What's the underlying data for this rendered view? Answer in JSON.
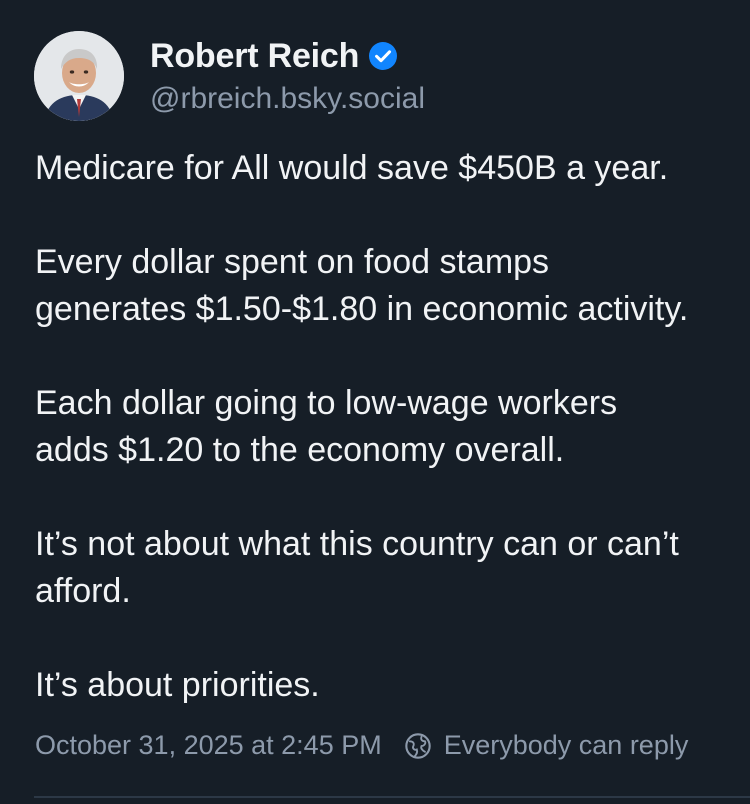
{
  "post": {
    "author": {
      "display_name": "Robert Reich",
      "handle": "@rbreich.bsky.social",
      "verified": true,
      "avatar_icon": "avatar-photo"
    },
    "text": "Medicare for All would save $450B a year.\n\nEvery dollar spent on food stamps\ngenerates $1.50-$1.80 in economic activity.\n\nEach dollar going to low-wage workers\nadds $1.20 to the economy overall.\n\nIt’s not about what this country can or can’t\nafford.\n\nIt’s about priorities.",
    "timestamp": "October 31, 2025 at 2:45 PM",
    "reply_setting": "Everybody can reply",
    "icons": {
      "verified": "verified-check-icon",
      "reply_setting": "globe-icon"
    }
  },
  "colors": {
    "background": "#161e27",
    "text_primary": "#f1f3f5",
    "text_secondary": "#8d9aab",
    "verified_badge": "#1185fe",
    "divider": "#2c3846"
  }
}
